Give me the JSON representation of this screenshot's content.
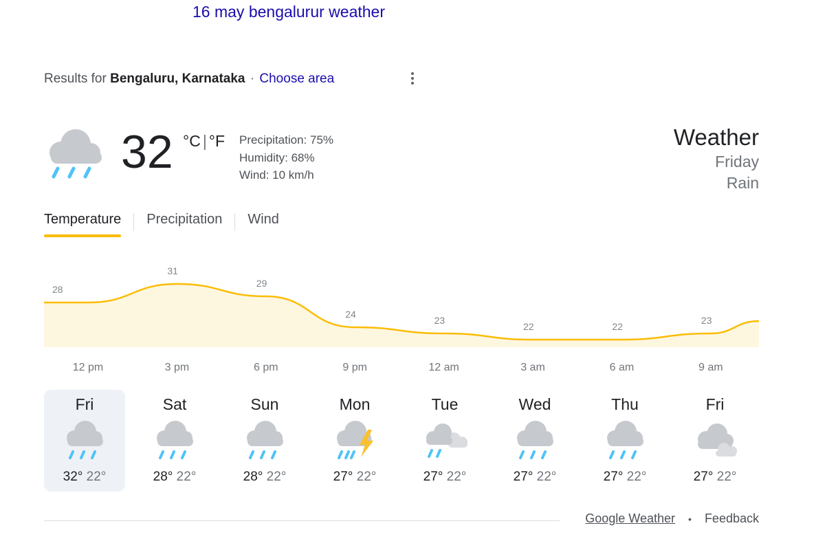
{
  "query": "16 may bengalurur weather",
  "location": {
    "prefix": "Results for",
    "name": "Bengaluru, Karnataka",
    "separator": "·",
    "choose_area": "Choose area"
  },
  "current": {
    "temperature": "32",
    "unit_c": "°C",
    "unit_sep": "|",
    "unit_f": "°F",
    "icon": "rain-cloud-icon",
    "precipitation": "Precipitation: 75%",
    "humidity": "Humidity: 68%",
    "wind": "Wind: 10 km/h"
  },
  "header": {
    "title": "Weather",
    "day": "Friday",
    "condition": "Rain"
  },
  "tabs": [
    "Temperature",
    "Precipitation",
    "Wind"
  ],
  "active_tab": "Temperature",
  "chart_data": {
    "type": "area",
    "x": [
      "12 pm",
      "3 pm",
      "6 pm",
      "9 pm",
      "12 am",
      "3 am",
      "6 am",
      "9 am"
    ],
    "labels": [
      28,
      31,
      29,
      24,
      23,
      22,
      22,
      23
    ],
    "ylim": [
      0,
      34
    ],
    "color": "#fbbc04",
    "fill": "#fef7e0"
  },
  "forecast": [
    {
      "day": "Fri",
      "high": "32°",
      "low": "22°",
      "icon": "rain-cloud-icon"
    },
    {
      "day": "Sat",
      "high": "28°",
      "low": "22°",
      "icon": "rain-cloud-icon"
    },
    {
      "day": "Sun",
      "high": "28°",
      "low": "22°",
      "icon": "rain-cloud-icon"
    },
    {
      "day": "Mon",
      "high": "27°",
      "low": "22°",
      "icon": "thunderstorm-icon"
    },
    {
      "day": "Tue",
      "high": "27°",
      "low": "22°",
      "icon": "rain-cloudy-icon"
    },
    {
      "day": "Wed",
      "high": "27°",
      "low": "22°",
      "icon": "rain-cloud-icon"
    },
    {
      "day": "Thu",
      "high": "27°",
      "low": "22°",
      "icon": "rain-cloud-icon"
    },
    {
      "day": "Fri",
      "high": "27°",
      "low": "22°",
      "icon": "cloudy-icon"
    }
  ],
  "footer": {
    "source": "Google Weather",
    "dot": "•",
    "feedback": "Feedback"
  },
  "colors": {
    "link": "#1a0dab",
    "accent": "#fbbc04",
    "rain": "#4fc3f7",
    "lightning": "#fbc02d",
    "cloud": "#c6c9ce"
  }
}
